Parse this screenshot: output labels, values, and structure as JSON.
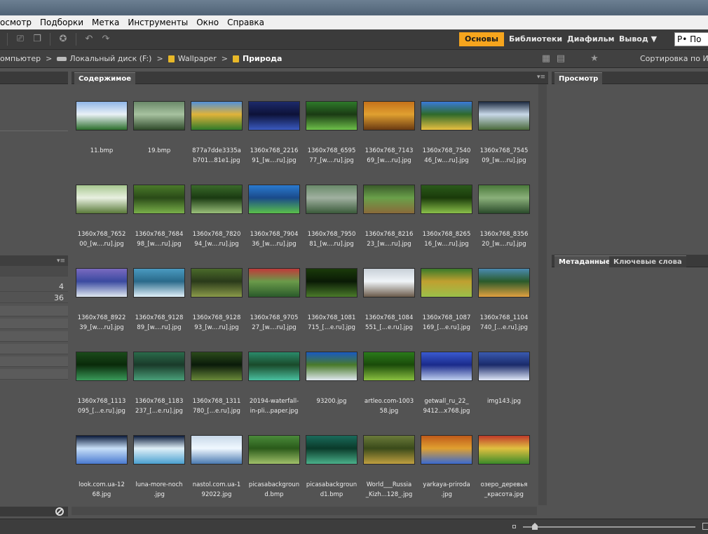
{
  "menu": [
    "осмотр",
    "Подборки",
    "Метка",
    "Инструменты",
    "Окно",
    "Справка"
  ],
  "workspaces": [
    {
      "label": "Основы",
      "active": true
    },
    {
      "label": "Библиотеки",
      "active": false
    },
    {
      "label": "Диафильм",
      "active": false
    },
    {
      "label": "Вывод ▼",
      "active": false
    }
  ],
  "search": {
    "value": "Ρ• По"
  },
  "path": {
    "computer": "омпьютер",
    "drive": "Локальный диск (F:)",
    "folder1": "Wallpaper",
    "folder2": "Природа"
  },
  "sort_label": "Сортировка по Име",
  "panels": {
    "content_tab": "Содержимое",
    "preview_tab": "Просмотр",
    "metadata_tab": "Метаданные",
    "keywords_tab": "Ключевые слова"
  },
  "left_panel": {
    "count_a": "4",
    "count_b": "36"
  },
  "files": [
    {
      "name": "11.bmp",
      "colors": [
        "#8fb6e8",
        "#2c6e2c",
        "#e9f1f6"
      ]
    },
    {
      "name": "19.bmp",
      "colors": [
        "#6b8a6a",
        "#2f4a2a",
        "#a7c2a0"
      ]
    },
    {
      "name": "877a7dde3335a\nb701...81e1.jpg",
      "colors": [
        "#5390d8",
        "#2f7a2a",
        "#e0b33a"
      ]
    },
    {
      "name": "1360x768_2216\n91_[w....ru].jpg",
      "colors": [
        "#1c2a6a",
        "#3a5ac0",
        "#0d1238"
      ]
    },
    {
      "name": "1360x768_6595\n77_[w....ru].jpg",
      "colors": [
        "#2e7a2a",
        "#6ec04a",
        "#1a3a14"
      ]
    },
    {
      "name": "1360x768_7143\n69_[w....ru].jpg",
      "colors": [
        "#c5721a",
        "#6a3a12",
        "#e0a030"
      ]
    },
    {
      "name": "1360x768_7540\n46_[w....ru].jpg",
      "colors": [
        "#3a7ad8",
        "#e8c040",
        "#2f6a2a"
      ]
    },
    {
      "name": "1360x768_7545\n09_[w....ru].jpg",
      "colors": [
        "#1c2a40",
        "#4a6a3a",
        "#c8d8e8"
      ]
    },
    {
      "name": "1360x768_7652\n00_[w....ru].jpg",
      "colors": [
        "#a8c890",
        "#5a7a3a",
        "#e8f0e0"
      ]
    },
    {
      "name": "1360x768_7684\n98_[w....ru].jpg",
      "colors": [
        "#4a7a2a",
        "#7ab04a",
        "#2a4a18"
      ]
    },
    {
      "name": "1360x768_7820\n94_[w....ru].jpg",
      "colors": [
        "#3a6a2a",
        "#9ac07a",
        "#1a3a12"
      ]
    },
    {
      "name": "1360x768_7904\n36_[w....ru].jpg",
      "colors": [
        "#2a7ad0",
        "#5ac04a",
        "#1a4a8a"
      ]
    },
    {
      "name": "1360x768_7950\n81_[w....ru].jpg",
      "colors": [
        "#6a8a6a",
        "#3a5a3a",
        "#a0b0a0"
      ]
    },
    {
      "name": "1360x768_8216\n23_[w....ru].jpg",
      "colors": [
        "#3a5a2a",
        "#8a6a3a",
        "#6aa04a"
      ]
    },
    {
      "name": "1360x768_8265\n16_[w....ru].jpg",
      "colors": [
        "#2a5a1a",
        "#8ac04a",
        "#1a3a0a"
      ]
    },
    {
      "name": "1360x768_8356\n20_[w....ru].jpg",
      "colors": [
        "#4a7a3a",
        "#2a4a2a",
        "#8ab07a"
      ]
    },
    {
      "name": "1360x768_8922\n39_[w....ru].jpg",
      "colors": [
        "#7a6ac0",
        "#e0e8f0",
        "#3a4aa0"
      ]
    },
    {
      "name": "1360x768_9128\n89_[w....ru].jpg",
      "colors": [
        "#4a9ac0",
        "#e0f0f8",
        "#2a6a8a"
      ]
    },
    {
      "name": "1360x768_9128\n93_[w....ru].jpg",
      "colors": [
        "#4a6a2a",
        "#8a9a4a",
        "#2a3a1a"
      ]
    },
    {
      "name": "1360x768_9705\n27_[w....ru].jpg",
      "colors": [
        "#c03a3a",
        "#2a5a2a",
        "#6a9a4a"
      ]
    },
    {
      "name": "1360x768_1081\n715_[...e.ru].jpg",
      "colors": [
        "#1a3a0a",
        "#4a7a2a",
        "#0a1a05"
      ]
    },
    {
      "name": "1360x768_1084\n551_[...e.ru].jpg",
      "colors": [
        "#c8d0d8",
        "#6a5a4a",
        "#f0f4f8"
      ]
    },
    {
      "name": "1360x768_1087\n169_[...e.ru].jpg",
      "colors": [
        "#3a7a2a",
        "#9ac04a",
        "#c0a030"
      ]
    },
    {
      "name": "1360x768_1104\n740_[...e.ru].jpg",
      "colors": [
        "#4a8ab0",
        "#e0a040",
        "#2a5a2a"
      ]
    },
    {
      "name": "1360x768_1113\n095_[...e.ru].jpg",
      "colors": [
        "#1a4a1a",
        "#3a9a5a",
        "#0a2a0a"
      ]
    },
    {
      "name": "1360x768_1183\n237_[...e.ru].jpg",
      "colors": [
        "#2a6a4a",
        "#4aa07a",
        "#1a3a2a"
      ]
    },
    {
      "name": "1360x768_1311\n780_[...e.ru].jpg",
      "colors": [
        "#2a4a1a",
        "#6a8a3a",
        "#0a1a0a"
      ]
    },
    {
      "name": "20194-waterfall-\nin-pli...paper.jpg",
      "colors": [
        "#2a8a6a",
        "#4ac0a0",
        "#1a4a2a"
      ]
    },
    {
      "name": "93200.jpg",
      "colors": [
        "#1a5ac0",
        "#e0e8f0",
        "#4a7a2a"
      ]
    },
    {
      "name": "artleo.com-1003\n58.jpg",
      "colors": [
        "#2a7a1a",
        "#8ac040",
        "#1a4a0a"
      ]
    },
    {
      "name": "getwall_ru_22_\n9412...x768.jpg",
      "colors": [
        "#3a5ad0",
        "#c0d0f0",
        "#1a2a8a"
      ]
    },
    {
      "name": "img143.jpg",
      "colors": [
        "#3a5ab0",
        "#e0e8f8",
        "#1a2a6a"
      ]
    },
    {
      "name": "look.com.ua-12\n68.jpg",
      "colors": [
        "#0a1a3a",
        "#4a7ad0",
        "#c8e0f8"
      ]
    },
    {
      "name": "luna-more-noch\n.jpg",
      "colors": [
        "#0a1a3a",
        "#4aa0d0",
        "#e0f0f8"
      ]
    },
    {
      "name": "nastol.com.ua-1\n92022.jpg",
      "colors": [
        "#c8d8e8",
        "#4a7ab0",
        "#f0f8ff"
      ]
    },
    {
      "name": "picasabackgroun\nd.bmp",
      "colors": [
        "#4a8a3a",
        "#a0c06a",
        "#2a5a1a"
      ]
    },
    {
      "name": "picasabackgroun\nd1.bmp",
      "colors": [
        "#1a6a5a",
        "#4ab08a",
        "#0a3a2a"
      ]
    },
    {
      "name": "World___Russia\n_Kizh...128_.jpg",
      "colors": [
        "#6a7a3a",
        "#c0a040",
        "#3a4a1a"
      ]
    },
    {
      "name": "yarkaya-priroda\n.jpg",
      "colors": [
        "#c05a1a",
        "#3a6ad0",
        "#e0a030"
      ]
    },
    {
      "name": "озеро_деревья\n_красота.jpg",
      "colors": [
        "#c03a2a",
        "#3a8a2a",
        "#e0c040"
      ]
    }
  ]
}
